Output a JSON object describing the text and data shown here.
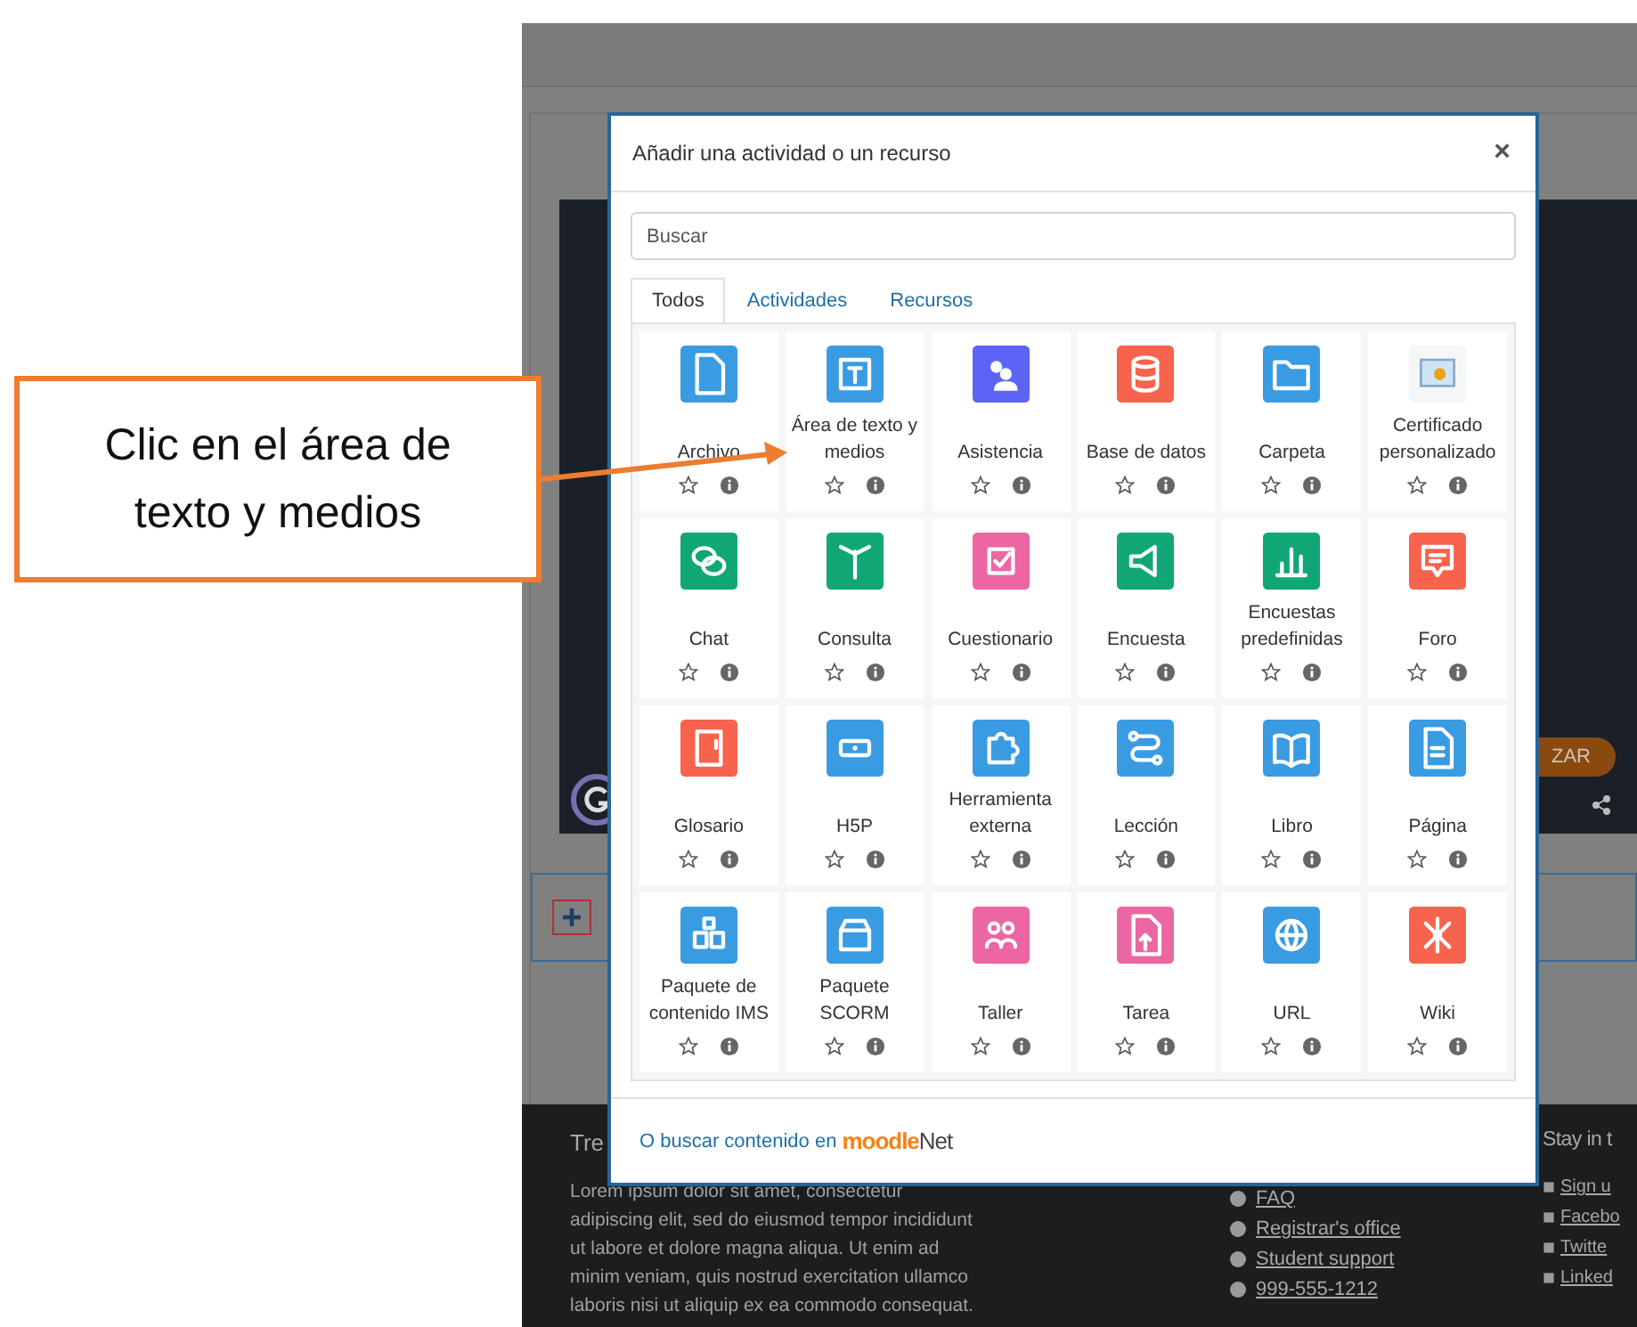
{
  "callout": {
    "text": "Clic en el área de texto y medios"
  },
  "background": {
    "hero_button": "ZAR",
    "footer": {
      "left_heading": "Tre",
      "paragraph": "Lorem ipsum dolor sit amet, consectetur adipiscing elit, sed do eiusmod tempor incididunt ut labore et dolore magna aliqua. Ut enim ad minim veniam, quis nostrud exercitation ullamco laboris nisi ut aliquip ex ea commodo consequat.",
      "links": [
        "FAQ",
        "Registrar's office",
        "Student support",
        "999-555-1212"
      ],
      "right_heading": "Stay in t",
      "social": [
        "Sign u",
        "Facebo",
        "Twitte",
        "Linked"
      ]
    }
  },
  "modal": {
    "title": "Añadir una actividad o un recurso",
    "close": "×",
    "search": {
      "placeholder": "Buscar"
    },
    "tabs": [
      {
        "label": "Todos",
        "selected": true
      },
      {
        "label": "Actividades",
        "selected": false
      },
      {
        "label": "Recursos",
        "selected": false
      }
    ],
    "tiles": [
      {
        "label": "Archivo",
        "color": "#399be2",
        "starred": false
      },
      {
        "label": "Área de texto y medios",
        "color": "#399be2",
        "starred": false
      },
      {
        "label": "Asistencia",
        "color": "#5d63f6",
        "starred": false
      },
      {
        "label": "Base de datos",
        "color": "#f7634d",
        "starred": false
      },
      {
        "label": "Carpeta",
        "color": "#399be2",
        "starred": false
      },
      {
        "label": "Certificado personalizado",
        "color": "#f5f6f8",
        "starred": false
      },
      {
        "label": "Chat",
        "color": "#11a676",
        "starred": false
      },
      {
        "label": "Consulta",
        "color": "#11a676",
        "starred": false
      },
      {
        "label": "Cuestionario",
        "color": "#eb66a2",
        "starred": false
      },
      {
        "label": "Encuesta",
        "color": "#11a676",
        "starred": false
      },
      {
        "label": "Encuestas predefinidas",
        "color": "#11a676",
        "starred": false
      },
      {
        "label": "Foro",
        "color": "#f7634d",
        "starred": false
      },
      {
        "label": "Glosario",
        "color": "#f7634d",
        "starred": false
      },
      {
        "label": "H5P",
        "color": "#399be2",
        "starred": false
      },
      {
        "label": "Herramienta externa",
        "color": "#399be2",
        "starred": false
      },
      {
        "label": "Lección",
        "color": "#399be2",
        "starred": false
      },
      {
        "label": "Libro",
        "color": "#399be2",
        "starred": false
      },
      {
        "label": "Página",
        "color": "#399be2",
        "starred": false
      },
      {
        "label": "Paquete de contenido IMS",
        "color": "#399be2",
        "starred": false
      },
      {
        "label": "Paquete SCORM",
        "color": "#399be2",
        "starred": false
      },
      {
        "label": "Taller",
        "color": "#eb66a2",
        "starred": false
      },
      {
        "label": "Tarea",
        "color": "#eb66a2",
        "starred": false
      },
      {
        "label": "URL",
        "color": "#399be2",
        "starred": false
      },
      {
        "label": "Wiki",
        "color": "#f7634d",
        "starred": false
      }
    ],
    "footer": {
      "text": "O buscar contenido en",
      "logo_main": "moodle",
      "logo_suffix": "Net"
    }
  }
}
